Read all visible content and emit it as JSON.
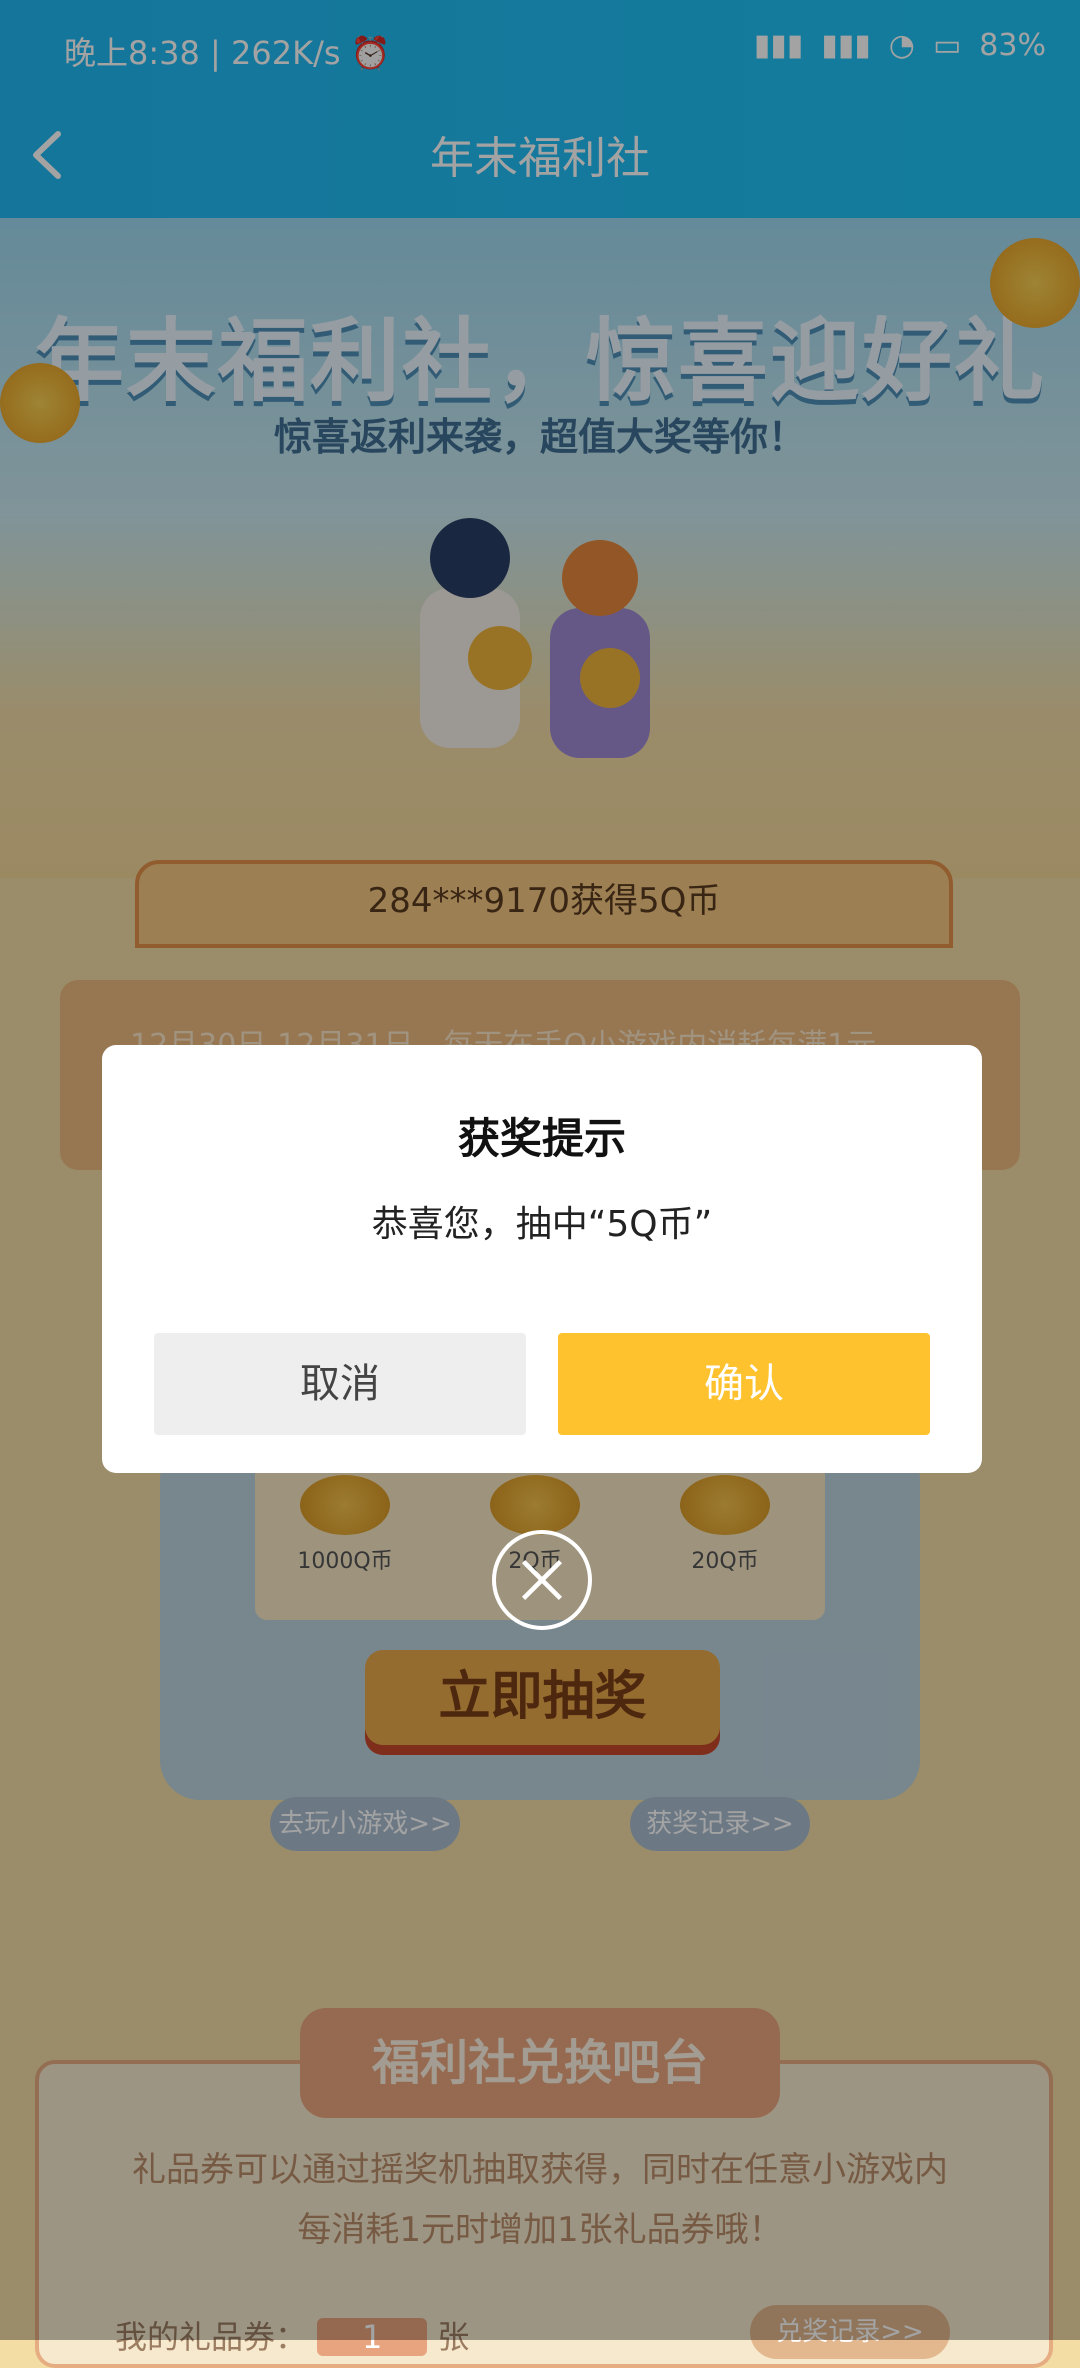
{
  "status_bar": {
    "time": "晚上8:38",
    "speed": "262K/s",
    "battery": "83",
    "battery_unit": "%"
  },
  "header": {
    "title": "年末福利社",
    "back_icon": "chevron-left-icon"
  },
  "hero": {
    "title": "年末福利社，惊喜迎好礼",
    "subtitle": "惊喜返利来袭，超值大奖等你！"
  },
  "winner_banner": {
    "text": "284***9170获得5Q币"
  },
  "info": {
    "text": "12月30日-12月31日，每天在手Q小游戏内消耗每满1元"
  },
  "machine": {
    "slots": [
      {
        "label": "1000Q币"
      },
      {
        "label": "2Q币"
      },
      {
        "label": "20Q币"
      }
    ],
    "draw_button": "立即抽奖",
    "play_games": "去玩小游戏>>",
    "win_records": "获奖记录>>"
  },
  "exchange": {
    "title": "福利社兑换吧台",
    "desc_line1": "礼品券可以通过摇奖机抽取获得，同时在任意小游戏内",
    "desc_line2": "每消耗1元时增加1张礼品券哦！",
    "ticket_label": "我的礼品券：",
    "ticket_count": "1",
    "ticket_unit": "张",
    "exchange_records": "兑奖记录>>"
  },
  "modal": {
    "title": "获奖提示",
    "message": "恭喜您，抽中“5Q币”",
    "cancel": "取消",
    "confirm": "确认",
    "close_icon": "close-icon"
  },
  "colors": {
    "header_blue": "#21b8f2",
    "confirm_yellow": "#ffc22f",
    "cancel_gray": "#eeeeee"
  }
}
